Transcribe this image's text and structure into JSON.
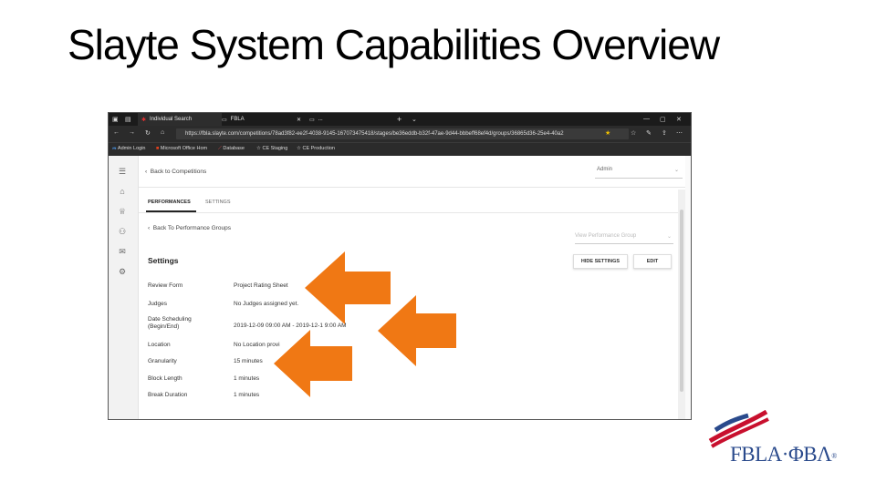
{
  "slide": {
    "title": "Slayte System Capabilities Overview"
  },
  "browser": {
    "tabs": [
      {
        "label": "Individual Search"
      },
      {
        "label": "FBLA"
      },
      {
        "label": "..."
      }
    ],
    "url": "https://fbla.slayte.com/competitions/78ad3f82-ee2f-4038-9145-167073475418/stages/be36eddb-b32f-47ae-9d44-bbbeff68ef4d/groups/36865d36-25e4-40a2",
    "favorites": [
      {
        "label": "Admin Login"
      },
      {
        "label": "Microsoft Office Hom"
      },
      {
        "label": "Database"
      },
      {
        "label": "CE Staging"
      },
      {
        "label": "CE Production"
      }
    ]
  },
  "app": {
    "back_to_competitions": "Back to Competitions",
    "admin_select": "Admin",
    "tabs": {
      "performances": "PERFORMANCES",
      "settings": "SETTINGS"
    },
    "back_to_groups": "Back To Performance Groups",
    "view_group_select": "View Performance Group",
    "settings_title": "Settings",
    "hide_settings_button": "HIDE SETTINGS",
    "edit_button": "EDIT",
    "fields": [
      {
        "label": "Review Form",
        "value": "Project Rating Sheet"
      },
      {
        "label": "Judges",
        "value": "No Judges assigned yet."
      },
      {
        "label": "Date Scheduling (Begin/End)",
        "value": "2019-12-09 09:00 AM - 2019-12-1  9:00 AM"
      },
      {
        "label": "Location",
        "value": "No Location provi"
      },
      {
        "label": "Granularity",
        "value": "15 minutes"
      },
      {
        "label": "Block Length",
        "value": "1 minutes"
      },
      {
        "label": "Break Duration",
        "value": "1 minutes"
      }
    ]
  },
  "colors": {
    "arrow": "#f07814",
    "chrome_dark": "#1b1b1b",
    "logo_blue": "#2a4a8c",
    "logo_red": "#c8102e"
  },
  "logo": {
    "text": "FBLA·ΦΒΛ",
    "mark": "®"
  }
}
